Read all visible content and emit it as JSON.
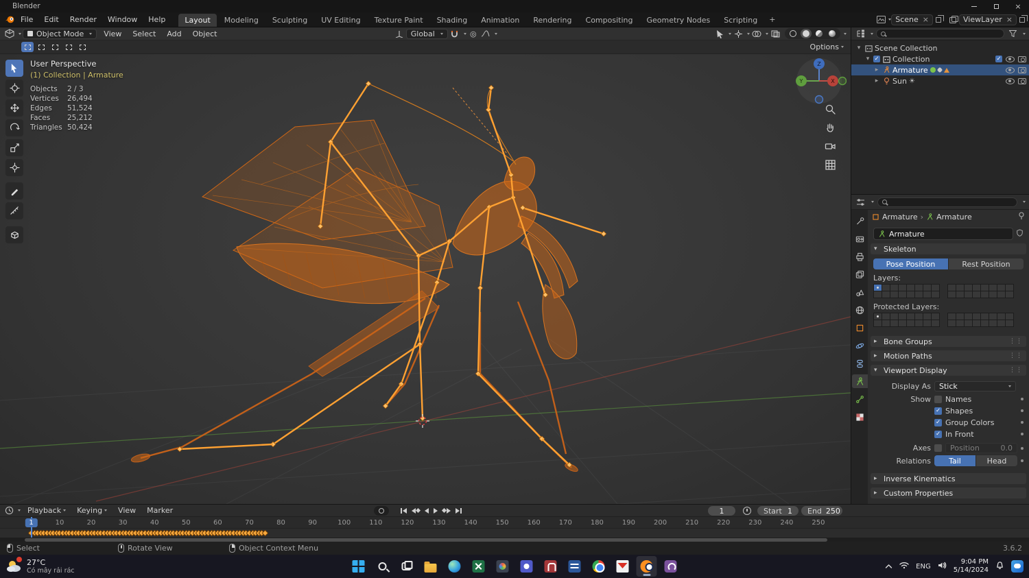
{
  "window": {
    "title": "Blender"
  },
  "topbar": {
    "menus": [
      "File",
      "Edit",
      "Render",
      "Window",
      "Help"
    ],
    "tabs": [
      "Layout",
      "Modeling",
      "Sculpting",
      "UV Editing",
      "Texture Paint",
      "Shading",
      "Animation",
      "Rendering",
      "Compositing",
      "Geometry Nodes",
      "Scripting"
    ],
    "active_tab": "Layout",
    "add_tab": "+",
    "scene_label": "Scene",
    "view_layer_label": "ViewLayer"
  },
  "viewport_header": {
    "mode": "Object Mode",
    "menus": [
      "View",
      "Select",
      "Add",
      "Object"
    ],
    "orientation": "Global",
    "options": "Options"
  },
  "viewport": {
    "overlay_title": "User Perspective",
    "overlay_context": "(1) Collection | Armature",
    "stats": [
      [
        "Objects",
        "2 / 3"
      ],
      [
        "Vertices",
        "26,494"
      ],
      [
        "Edges",
        "51,524"
      ],
      [
        "Faces",
        "25,212"
      ],
      [
        "Triangles",
        "50,424"
      ]
    ],
    "gizmo": {
      "x": "X",
      "y": "Y",
      "z": "Z"
    }
  },
  "outliner": {
    "rows": [
      {
        "label": "Scene Collection",
        "depth": 0,
        "icon": "scene-collection",
        "expander": "▾",
        "checkbox": false,
        "selected": false,
        "badges": false,
        "sun": false
      },
      {
        "label": "Collection",
        "depth": 1,
        "icon": "collection",
        "expander": "▾",
        "checkbox": true,
        "selected": false,
        "badges": false,
        "sun": false
      },
      {
        "label": "Armature",
        "depth": 2,
        "icon": "armature",
        "expander": "▸",
        "checkbox": false,
        "selected": true,
        "badges": true,
        "sun": false
      },
      {
        "label": "Sun",
        "depth": 2,
        "icon": "light",
        "expander": "▸",
        "checkbox": false,
        "selected": false,
        "badges": false,
        "sun": true
      }
    ]
  },
  "properties": {
    "breadcrumb": {
      "object": "Armature",
      "separator": "›",
      "data": "Armature"
    },
    "name_value": "Armature",
    "skeleton": {
      "title": "Skeleton",
      "pose": "Pose Position",
      "rest": "Rest Position",
      "layers_label": "Layers:",
      "protected_label": "Protected Layers:",
      "layers": {
        "groups": 2,
        "rows": 2,
        "cols": 8,
        "enabled": [
          0
        ],
        "dots": [
          0
        ]
      },
      "protected_layers": {
        "groups": 2,
        "rows": 2,
        "cols": 8,
        "enabled": [],
        "dots": [
          0
        ]
      }
    },
    "panels_collapsed_mid": [
      "Bone Groups",
      "Motion Paths"
    ],
    "viewport_display": {
      "title": "Viewport Display",
      "display_as_label": "Display As",
      "display_as_value": "Stick",
      "show_label": "Show",
      "checks": [
        {
          "label": "Names",
          "on": false
        },
        {
          "label": "Shapes",
          "on": true
        },
        {
          "label": "Group Colors",
          "on": true
        },
        {
          "label": "In Front",
          "on": true
        }
      ],
      "axes_label": "Axes",
      "position_label": "Position",
      "position_value": "0.0",
      "relations_label": "Relations",
      "tail": "Tail",
      "head": "Head"
    },
    "panels_collapsed_bottom": [
      "Inverse Kinematics",
      "Custom Properties"
    ]
  },
  "timeline": {
    "menus": [
      "Playback",
      "Keying",
      "View",
      "Marker"
    ],
    "current_frame": "1",
    "start_label": "Start",
    "start_value": "1",
    "end_label": "End",
    "end_value": "250",
    "ruler": [
      10,
      20,
      30,
      40,
      50,
      60,
      70,
      80,
      90,
      100,
      110,
      120,
      130,
      140,
      150,
      160,
      170,
      180,
      190,
      200,
      210,
      220,
      230,
      240,
      250
    ],
    "keyframes": {
      "first_frame": 1,
      "last_frame": 75
    }
  },
  "status": {
    "hints": [
      "Select",
      "Rotate View",
      "Object Context Menu"
    ],
    "version": "3.6.2"
  },
  "taskbar": {
    "weather_temp": "27°C",
    "weather_desc": "Có mây rải rác",
    "icons": [
      "start",
      "search",
      "task-view",
      "file-explorer",
      "edge",
      "excel",
      "photos",
      "teams",
      "access",
      "word",
      "chrome",
      "gmail",
      "blender",
      "viber"
    ],
    "active_icon": "blender",
    "tray_lang": "ENG",
    "tray_time": "9:04 PM",
    "tray_date": "5/14/2024"
  },
  "colors": {
    "accent": "#4772b3",
    "bone_orange": "#ffa132",
    "mesh_orange": "#cf6716",
    "selected_row": "#33527d"
  }
}
